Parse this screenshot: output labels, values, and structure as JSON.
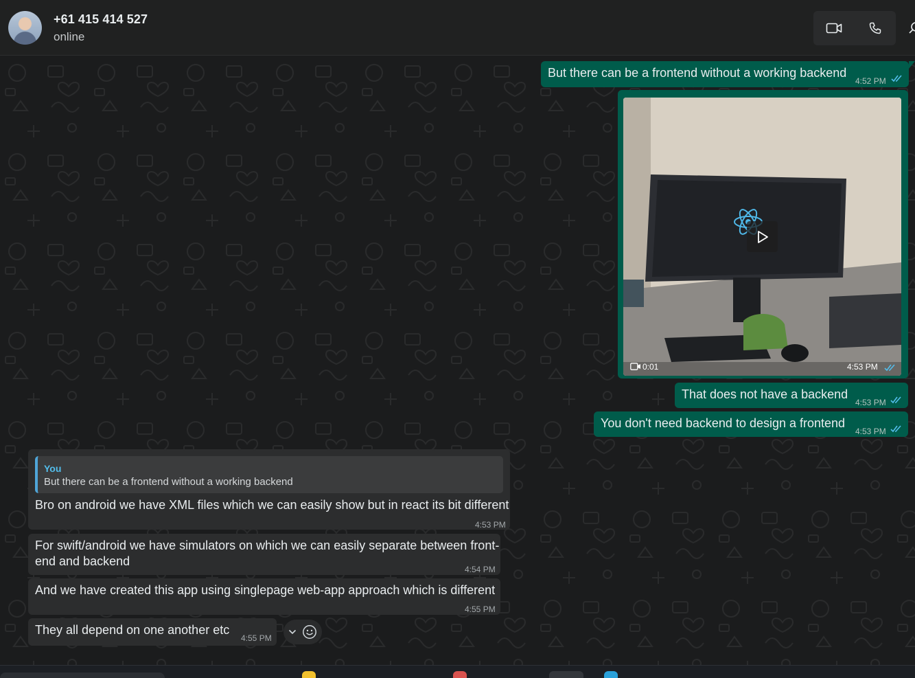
{
  "header": {
    "contact_name": "+61 415 414 527",
    "status": "online",
    "video_call_icon": "video-camera-icon",
    "voice_call_icon": "phone-icon",
    "search_icon": "search-icon"
  },
  "messages": {
    "m1": {
      "text": "But there can be a frontend without a working backend",
      "time": "4:52 PM",
      "direction": "outgoing",
      "read": true
    },
    "video": {
      "duration": "0:01",
      "time": "4:53 PM",
      "direction": "outgoing",
      "read": true
    },
    "m2": {
      "text": "That does not have a backend",
      "time": "4:53 PM",
      "direction": "outgoing",
      "read": true
    },
    "m3": {
      "text": "You don't need backend to design a frontend",
      "time": "4:53 PM",
      "direction": "outgoing",
      "read": true
    },
    "m4": {
      "quote_author": "You",
      "quote_text": "But there can be a frontend without a working backend",
      "text": "Bro on android we have XML files which we can easily show but in react its bit different",
      "time": "4:53 PM",
      "direction": "incoming"
    },
    "m5": {
      "line1": "For swift/android we have simulators on which we can easily separate between front-",
      "line2": "end and backend",
      "time": "4:54 PM",
      "direction": "incoming"
    },
    "m6": {
      "text": "And we have created this app using singlepage web-app  approach which is different",
      "time": "4:55 PM",
      "direction": "incoming"
    },
    "m7": {
      "text": "They all depend on one another etc",
      "time": "4:55 PM",
      "direction": "incoming"
    }
  },
  "colors": {
    "outgoing_bubble": "#005c4b",
    "incoming_bubble": "#2c2d2e",
    "read_ticks": "#53bdeb",
    "background": "#1b1c1d"
  }
}
